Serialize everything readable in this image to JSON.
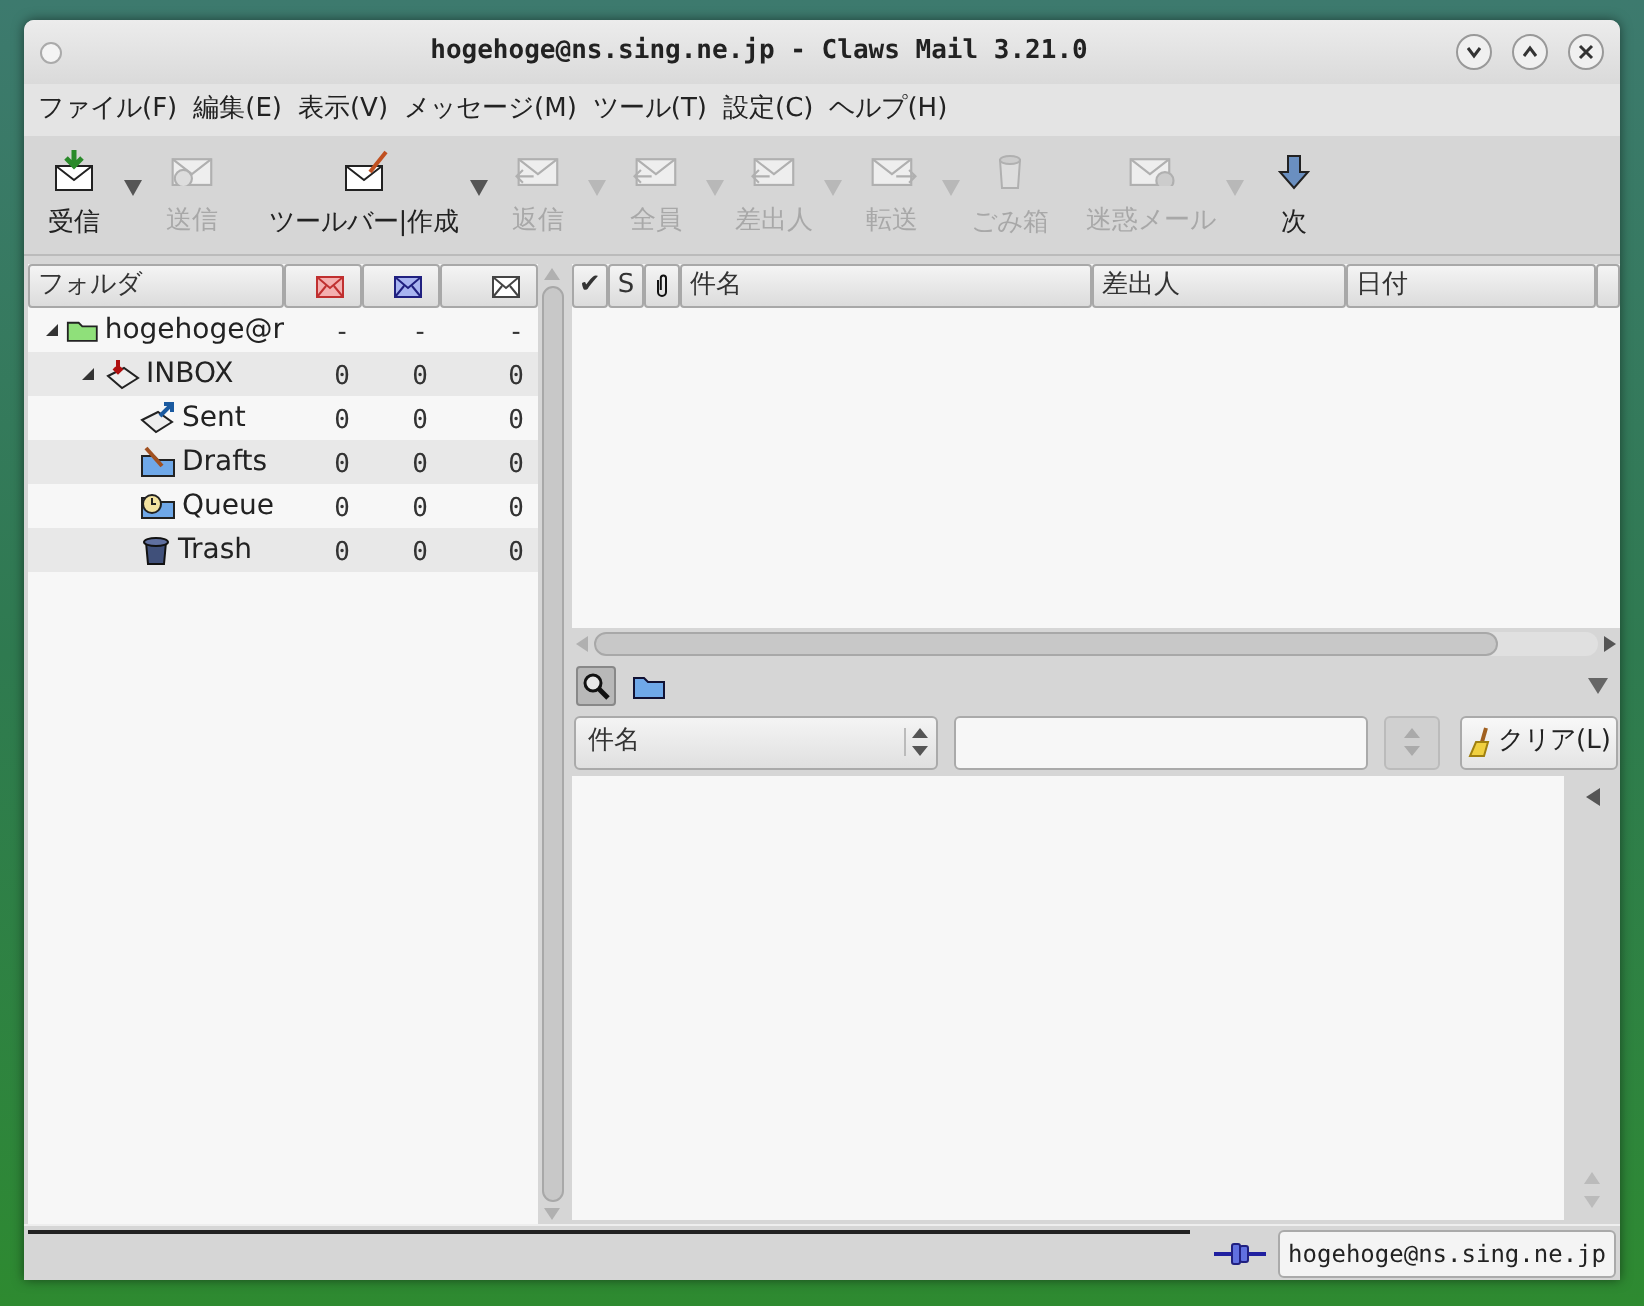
{
  "window": {
    "title": "hogehoge@ns.sing.ne.jp - Claws Mail 3.21.0"
  },
  "menu": [
    "ファイル(F)",
    "編集(E)",
    "表示(V)",
    "メッセージ(M)",
    "ツール(T)",
    "設定(C)",
    "ヘルプ(H)"
  ],
  "toolbar": [
    {
      "kind": "receive",
      "label": "受信",
      "disabled": false,
      "dropdown": true
    },
    {
      "kind": "send",
      "label": "送信",
      "disabled": true,
      "dropdown": false
    },
    {
      "kind": "compose",
      "label": "ツールバー|作成",
      "disabled": false,
      "dropdown": true
    },
    {
      "kind": "reply",
      "label": "返信",
      "disabled": true,
      "dropdown": true
    },
    {
      "kind": "reply_all",
      "label": "全員",
      "disabled": true,
      "dropdown": true
    },
    {
      "kind": "reply_sender",
      "label": "差出人",
      "disabled": true,
      "dropdown": true
    },
    {
      "kind": "forward",
      "label": "転送",
      "disabled": true,
      "dropdown": true
    },
    {
      "kind": "trash",
      "label": "ごみ箱",
      "disabled": true,
      "dropdown": false
    },
    {
      "kind": "spam",
      "label": "迷惑メール",
      "disabled": true,
      "dropdown": true
    },
    {
      "kind": "next",
      "label": "次",
      "disabled": false,
      "dropdown": false
    }
  ],
  "folder_pane": {
    "columns": [
      {
        "kind": "text",
        "label": "フォルダ"
      },
      {
        "kind": "new"
      },
      {
        "kind": "unread"
      },
      {
        "kind": "total"
      }
    ],
    "tree": [
      {
        "kind": "account",
        "name": "hogehoge@r",
        "counts": [
          "-",
          "-",
          "-"
        ],
        "expanded": true,
        "children": [
          {
            "kind": "inbox",
            "name": "INBOX",
            "counts": [
              "0",
              "0",
              "0"
            ],
            "expanded": true,
            "children": [
              {
                "kind": "sent",
                "name": "Sent",
                "counts": [
                  "0",
                  "0",
                  "0"
                ]
              },
              {
                "kind": "drafts",
                "name": "Drafts",
                "counts": [
                  "0",
                  "0",
                  "0"
                ]
              },
              {
                "kind": "queue",
                "name": "Queue",
                "counts": [
                  "0",
                  "0",
                  "0"
                ]
              },
              {
                "kind": "trash",
                "name": "Trash",
                "counts": [
                  "0",
                  "0",
                  "0"
                ]
              }
            ]
          }
        ]
      }
    ]
  },
  "message_list": {
    "columns": [
      {
        "kind": "mark",
        "label": "✔"
      },
      {
        "kind": "status",
        "label": "S"
      },
      {
        "kind": "attachment"
      },
      {
        "kind": "text",
        "label": "件名"
      },
      {
        "kind": "text",
        "label": "差出人"
      },
      {
        "kind": "text",
        "label": "日付"
      },
      {
        "kind": "cut"
      }
    ]
  },
  "quick_search": {
    "search_on": true,
    "type": "件名",
    "button": "クリア(L)"
  },
  "status_bar": {
    "account": "hogehoge@ns.sing.ne.jp"
  }
}
